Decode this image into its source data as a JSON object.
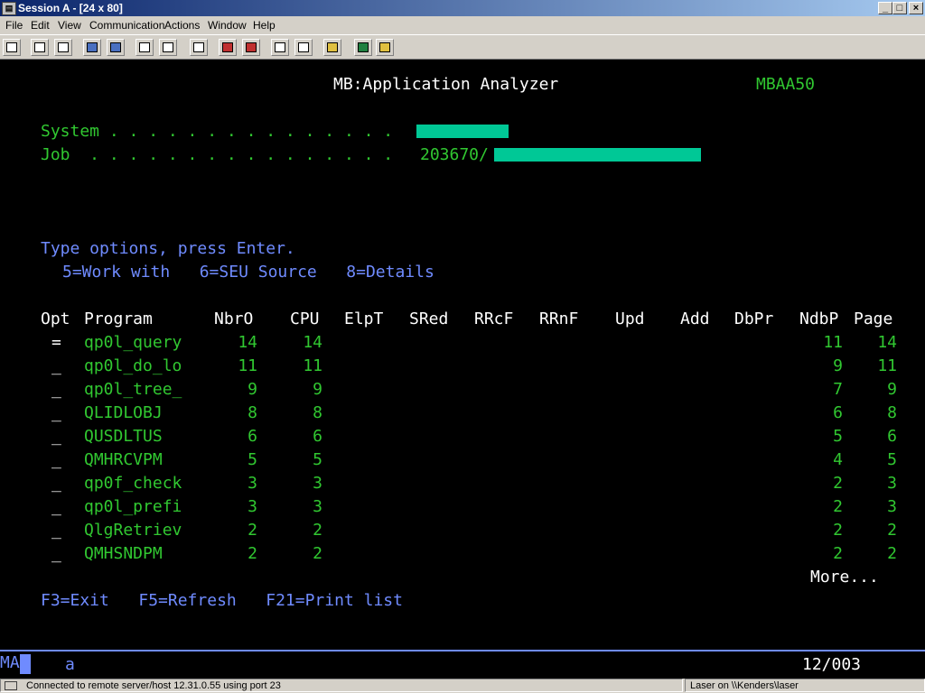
{
  "window": {
    "title": "Session A - [24 x 80]"
  },
  "menu": [
    "File",
    "Edit",
    "View",
    "Communication",
    "Actions",
    "Window",
    "Help"
  ],
  "screen": {
    "title": "MB:Application Analyzer",
    "screen_id": "MBAA50",
    "system_label": "System . . . . . . . . . . . . . . .",
    "job_label": "Job  . . . . . . . . . . . . . . . .",
    "job_value": "203670/",
    "instructions": "Type options, press Enter.",
    "options": "5=Work with   6=SEU Source   8=Details",
    "columns": [
      "Opt",
      "Program",
      "NbrO",
      "CPU",
      "ElpT",
      "SRed",
      "RRcF",
      "RRnF",
      "Upd",
      "Add",
      "DbPr",
      "NdbP",
      "Page"
    ],
    "rows": [
      {
        "opt": "=",
        "program": "qp0l_query",
        "nbro": "14",
        "cpu": "14",
        "ndbp": "11",
        "page": "14"
      },
      {
        "opt": "_",
        "program": "qp0l_do_lo",
        "nbro": "11",
        "cpu": "11",
        "ndbp": "9",
        "page": "11"
      },
      {
        "opt": "_",
        "program": "qp0l_tree_",
        "nbro": "9",
        "cpu": "9",
        "ndbp": "7",
        "page": "9"
      },
      {
        "opt": "_",
        "program": "QLIDLOBJ",
        "nbro": "8",
        "cpu": "8",
        "ndbp": "6",
        "page": "8"
      },
      {
        "opt": "_",
        "program": "QUSDLTUS",
        "nbro": "6",
        "cpu": "6",
        "ndbp": "5",
        "page": "6"
      },
      {
        "opt": "_",
        "program": "QMHRCVPM",
        "nbro": "5",
        "cpu": "5",
        "ndbp": "4",
        "page": "5"
      },
      {
        "opt": "_",
        "program": "qp0f_check",
        "nbro": "3",
        "cpu": "3",
        "ndbp": "2",
        "page": "3"
      },
      {
        "opt": "_",
        "program": "qp0l_prefi",
        "nbro": "3",
        "cpu": "3",
        "ndbp": "2",
        "page": "3"
      },
      {
        "opt": "_",
        "program": "QlgRetriev",
        "nbro": "2",
        "cpu": "2",
        "ndbp": "2",
        "page": "2"
      },
      {
        "opt": "_",
        "program": "QMHSNDPM",
        "nbro": "2",
        "cpu": "2",
        "ndbp": "2",
        "page": "2"
      }
    ],
    "more": "More...",
    "fkeys": "F3=Exit   F5=Refresh   F21=Print list"
  },
  "oia": {
    "indicator": "MA",
    "input_char": "a",
    "cursor_pos": "12/003"
  },
  "status": {
    "connection": "Connected to remote server/host 12.31.0.55 using port 23",
    "printer": "Laser on \\\\Kenders\\laser"
  },
  "colors": {
    "field_green": "#31c831",
    "highlight_bar": "#00c896",
    "blue_text": "#6f8bff"
  }
}
